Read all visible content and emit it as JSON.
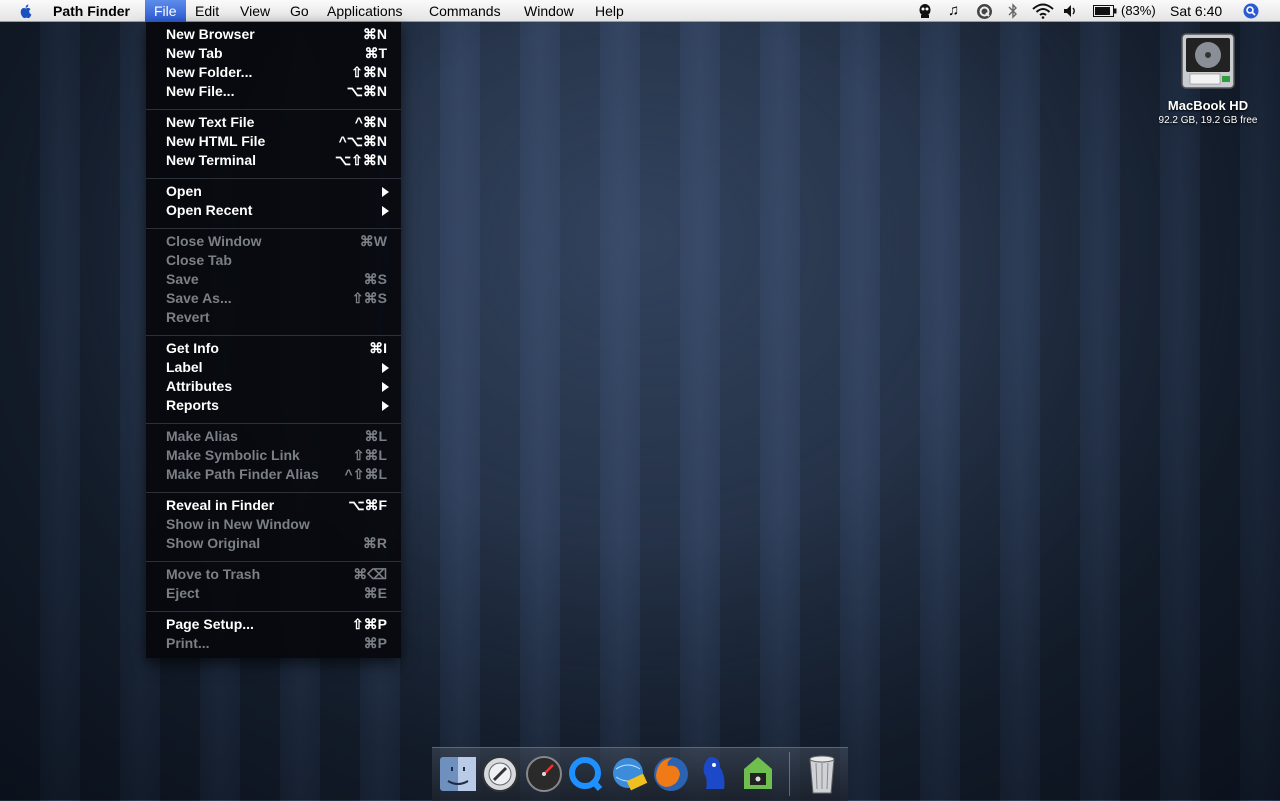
{
  "menubar": {
    "app_name": "Path Finder",
    "menus": [
      "File",
      "Edit",
      "View",
      "Go",
      "Applications",
      "Commands",
      "Window",
      "Help"
    ],
    "battery": "(83%)",
    "clock": "Sat 6:40"
  },
  "file_menu": {
    "items": [
      {
        "label": "New Browser",
        "shortcut": "⌘N",
        "enabled": true
      },
      {
        "label": "New Tab",
        "shortcut": "⌘T",
        "enabled": true
      },
      {
        "label": "New Folder...",
        "shortcut": "⇧⌘N",
        "enabled": true
      },
      {
        "label": "New File...",
        "shortcut": "⌥⌘N",
        "enabled": true
      },
      {
        "label": "New Text File",
        "shortcut": "^⌘N",
        "enabled": true
      },
      {
        "label": "New HTML File",
        "shortcut": "^⌥⌘N",
        "enabled": true
      },
      {
        "label": "New Terminal",
        "shortcut": "⌥⇧⌘N",
        "enabled": true
      },
      {
        "label": "Open",
        "shortcut": "",
        "submenu": true,
        "enabled": true
      },
      {
        "label": "Open Recent",
        "shortcut": "",
        "submenu": true,
        "enabled": true
      },
      {
        "label": "Close Window",
        "shortcut": "⌘W",
        "enabled": false
      },
      {
        "label": "Close Tab",
        "shortcut": "",
        "enabled": false
      },
      {
        "label": "Save",
        "shortcut": "⌘S",
        "enabled": false
      },
      {
        "label": "Save As...",
        "shortcut": "⇧⌘S",
        "enabled": false
      },
      {
        "label": "Revert",
        "shortcut": "",
        "enabled": false
      },
      {
        "label": "Get Info",
        "shortcut": "⌘I",
        "enabled": true
      },
      {
        "label": "Label",
        "shortcut": "",
        "submenu": true,
        "enabled": true
      },
      {
        "label": "Attributes",
        "shortcut": "",
        "submenu": true,
        "enabled": true
      },
      {
        "label": "Reports",
        "shortcut": "",
        "submenu": true,
        "enabled": true
      },
      {
        "label": "Make Alias",
        "shortcut": "⌘L",
        "enabled": false
      },
      {
        "label": "Make Symbolic Link",
        "shortcut": "⇧⌘L",
        "enabled": false
      },
      {
        "label": "Make Path Finder Alias",
        "shortcut": "^⇧⌘L",
        "enabled": false
      },
      {
        "label": "Reveal in Finder",
        "shortcut": "⌥⌘F",
        "enabled": true
      },
      {
        "label": "Show in New Window",
        "shortcut": "",
        "enabled": false
      },
      {
        "label": "Show Original",
        "shortcut": "⌘R",
        "enabled": false
      },
      {
        "label": "Move to Trash",
        "shortcut": "⌘⌫",
        "enabled": false
      },
      {
        "label": "Eject",
        "shortcut": "⌘E",
        "enabled": false
      },
      {
        "label": "Page Setup...",
        "shortcut": "⇧⌘P",
        "enabled": true
      },
      {
        "label": "Print...",
        "shortcut": "⌘P",
        "enabled": false
      }
    ]
  },
  "desktop": {
    "drive_name": "MacBook HD",
    "drive_info": "92.2 GB, 19.2 GB free"
  },
  "dock": {
    "apps": [
      "finder-icon",
      "compass-icon",
      "dashboard-icon",
      "quicktime-icon",
      "network-globe-icon",
      "firefox-icon",
      "adium-icon",
      "terminal-app-icon",
      "trash-icon"
    ]
  },
  "colors": {
    "highlight": "#2b5bd4",
    "disabled_text": "#7b7f86"
  }
}
